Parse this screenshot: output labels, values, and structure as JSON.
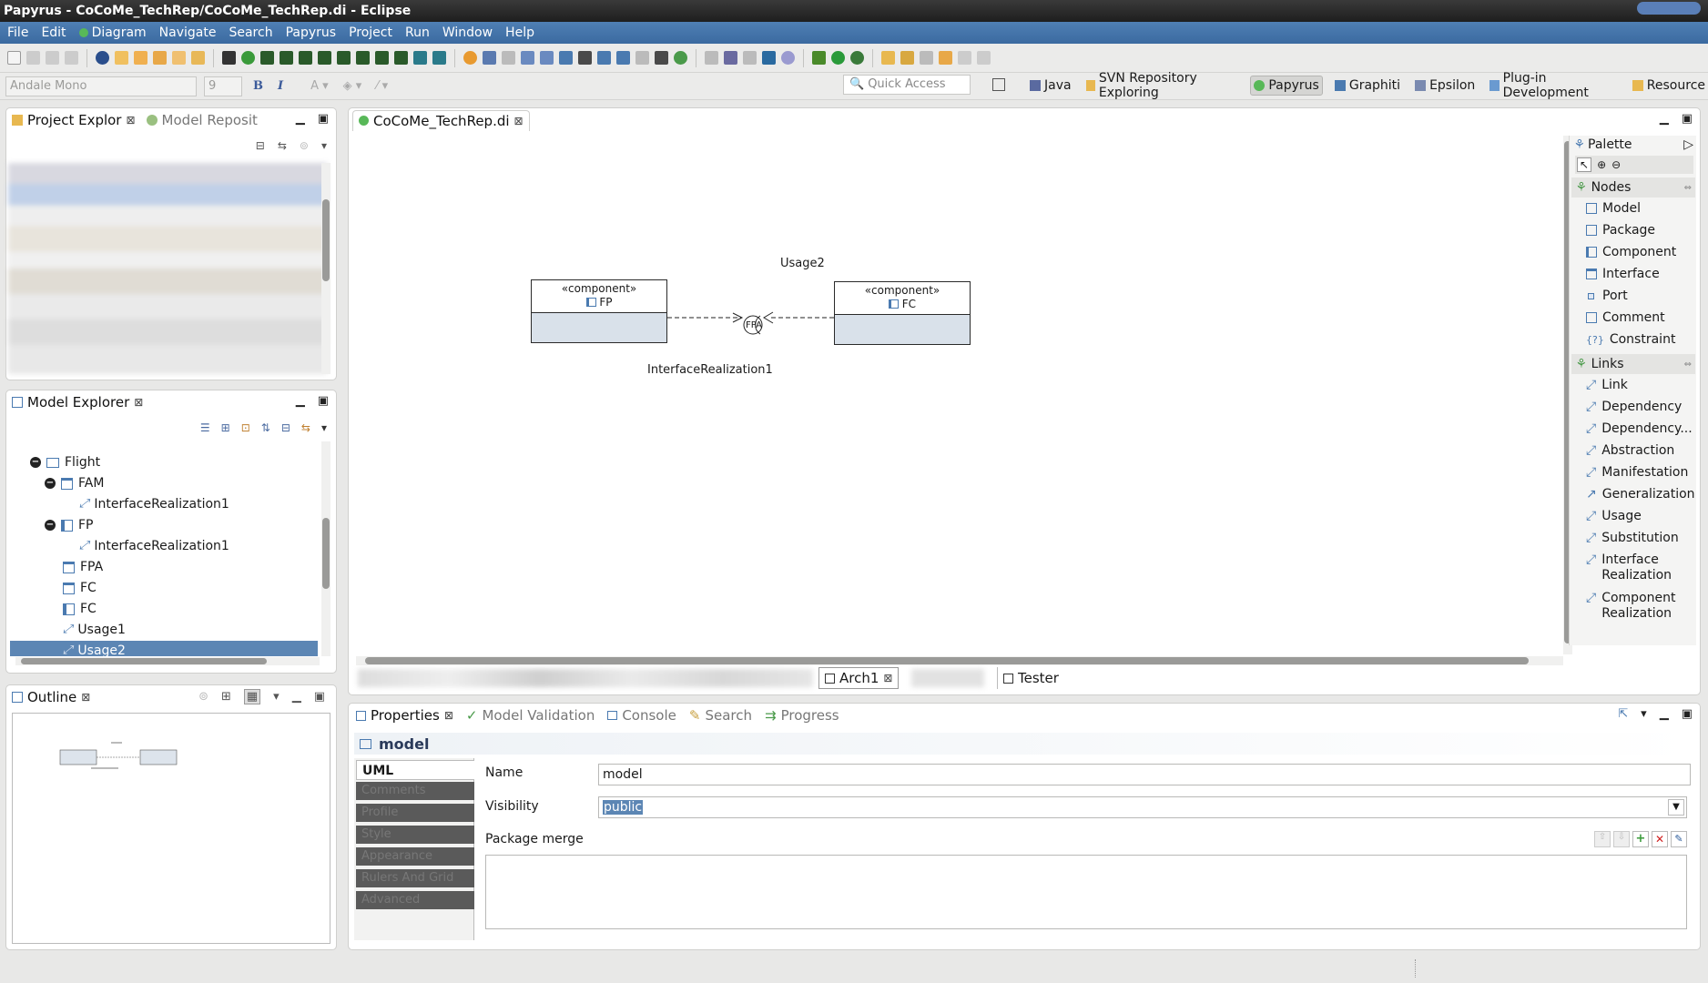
{
  "window": {
    "title": "Papyrus - CoCoMe_TechRep/CoCoMe_TechRep.di - Eclipse"
  },
  "menu": [
    "File",
    "Edit",
    "Diagram",
    "Navigate",
    "Search",
    "Papyrus",
    "Project",
    "Run",
    "Window",
    "Help"
  ],
  "toolbar": {
    "font_name": "Andale Mono",
    "font_size": "9",
    "bold": "B",
    "italic": "I",
    "quick_access_placeholder": "Quick Access"
  },
  "perspectives": [
    "Java",
    "SVN Repository Exploring",
    "Papyrus",
    "Graphiti",
    "Epsilon",
    "Plug-in Development",
    "Resource"
  ],
  "project_explorer": {
    "tabs": [
      "Project Explor",
      "Model Reposit"
    ]
  },
  "model_explorer": {
    "title": "Model Explorer",
    "tree": [
      {
        "label": "Flight",
        "indent": 0,
        "expanded": true,
        "icon": "package-icon"
      },
      {
        "label": "FAM",
        "indent": 1,
        "expanded": true,
        "icon": "interface-icon"
      },
      {
        "label": "InterfaceRealization1",
        "indent": 2,
        "icon": "realization-icon"
      },
      {
        "label": "FP",
        "indent": 1,
        "expanded": true,
        "icon": "component-icon"
      },
      {
        "label": "InterfaceRealization1",
        "indent": 2,
        "icon": "realization-icon"
      },
      {
        "label": "FPA",
        "indent": 1,
        "icon": "interface-icon"
      },
      {
        "label": "FC",
        "indent": 1,
        "icon": "interface-icon"
      },
      {
        "label": "FC",
        "indent": 1,
        "icon": "component-icon"
      },
      {
        "label": "Usage1",
        "indent": 1,
        "icon": "usage-icon"
      },
      {
        "label": "Usage2",
        "indent": 1,
        "icon": "usage-icon",
        "selected": true
      }
    ]
  },
  "outline": {
    "title": "Outline"
  },
  "editor": {
    "tab": "CoCoMe_TechRep.di",
    "diagram": {
      "fp": {
        "stereotype": "«component»",
        "name": "FP"
      },
      "fc": {
        "stereotype": "«component»",
        "name": "FC"
      },
      "interface_label": "FPA",
      "usage_label": "Usage2",
      "realization_label": "InterfaceRealization1"
    },
    "bottom_tabs": [
      "Arch1",
      "Tester"
    ]
  },
  "palette": {
    "title": "Palette",
    "nodes_title": "Nodes",
    "nodes": [
      "Model",
      "Package",
      "Component",
      "Interface",
      "Port",
      "Comment",
      "Constraint"
    ],
    "links_title": "Links",
    "links": [
      "Link",
      "Dependency",
      "Dependency...",
      "Abstraction",
      "Manifestation",
      "Generalization",
      "Usage",
      "Substitution",
      "Interface Realization",
      "Component Realization"
    ]
  },
  "properties": {
    "tabs": [
      "Properties",
      "Model Validation",
      "Console",
      "Search",
      "Progress"
    ],
    "header": "model",
    "side_tabs": [
      "UML",
      "Comments",
      "Profile",
      "Style",
      "Appearance",
      "Rulers And Grid",
      "Advanced"
    ],
    "name_label": "Name",
    "name_value": "model",
    "visibility_label": "Visibility",
    "visibility_value": "public",
    "package_merge_label": "Package merge"
  }
}
